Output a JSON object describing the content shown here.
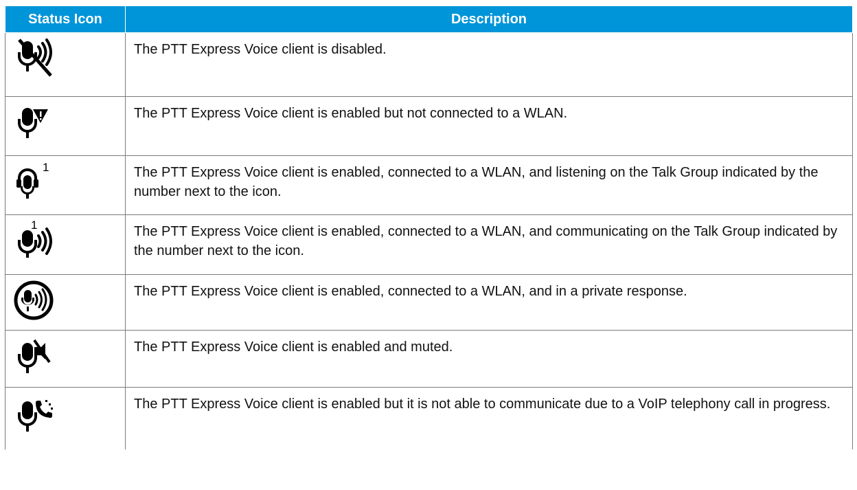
{
  "table": {
    "headers": {
      "icon": "Status Icon",
      "description": "Description"
    },
    "rows": [
      {
        "icon": "mic-disabled-icon",
        "description": "The PTT Express Voice client is disabled."
      },
      {
        "icon": "mic-no-wlan-icon",
        "description": "The PTT Express Voice client is enabled but not connected to a WLAN."
      },
      {
        "icon": "headset-listening-icon",
        "badge": "1",
        "description": "The PTT Express Voice client is enabled, connected to a WLAN, and listening on the Talk Group indicated by the number next to the icon."
      },
      {
        "icon": "mic-communicating-icon",
        "badge": "1",
        "description": "The PTT Express Voice client is enabled, connected to a WLAN, and communicating on the Talk Group indicated by the number next to the icon."
      },
      {
        "icon": "mic-private-response-icon",
        "description": "The PTT Express Voice client is enabled, connected to a WLAN, and in a private response."
      },
      {
        "icon": "mic-muted-icon",
        "description": "The PTT Express Voice client is enabled and muted."
      },
      {
        "icon": "mic-voip-call-icon",
        "description": "The PTT Express Voice client is enabled but it is not able to communicate due to a VoIP telephony call in progress."
      }
    ]
  }
}
